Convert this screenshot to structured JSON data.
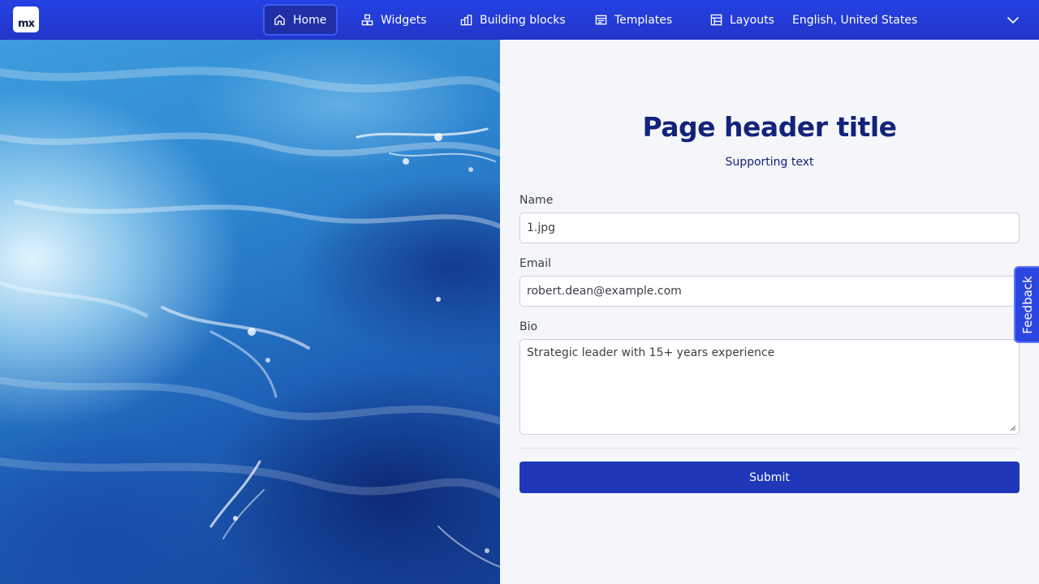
{
  "header": {
    "logo_text": "mx",
    "nav": [
      {
        "label": "Home",
        "icon": "home-icon",
        "active": true
      },
      {
        "label": "Widgets",
        "icon": "widgets-icon",
        "active": false
      },
      {
        "label": "Building blocks",
        "icon": "building-blocks-icon",
        "active": false
      },
      {
        "label": "Templates",
        "icon": "templates-icon",
        "active": false
      },
      {
        "label": "Layouts",
        "icon": "layouts-icon",
        "active": false
      }
    ],
    "language": "English, United States",
    "language_icon": "chevron-down-icon"
  },
  "hero": {
    "image": "ocean-waves"
  },
  "form": {
    "title": "Page header title",
    "subtitle": "Supporting text",
    "name_label": "Name",
    "name_value": "1.jpg",
    "email_label": "Email",
    "email_value": "robert.dean@example.com",
    "bio_label": "Bio",
    "bio_value": "Strategic leader with 15+ years experience",
    "submit_label": "Submit"
  },
  "feedback": {
    "label": "Feedback"
  },
  "colors": {
    "topbar": "#2541e3",
    "active_nav": "#1f2fa6",
    "title": "#13237a",
    "submit": "#1f37b8",
    "background": "#f5f6fa"
  }
}
